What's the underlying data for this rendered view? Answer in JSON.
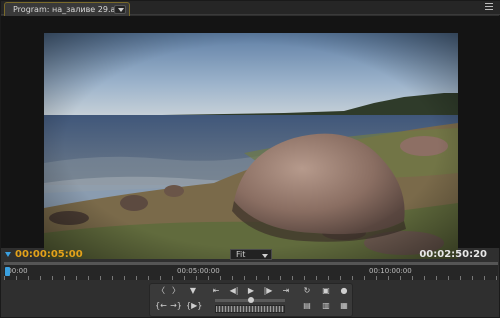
{
  "tab": {
    "label": "Program: на_заливе 29.avi"
  },
  "timecode": {
    "current": "00:00:05:00",
    "duration": "00:02:50:20"
  },
  "zoom": {
    "selected": "Fit"
  },
  "ruler": {
    "labels": [
      ":00:00",
      "00:05:00:00",
      "00:10:00:00"
    ],
    "playhead_fraction": 0.003
  },
  "icons": {
    "mark_in": "mark-in-icon",
    "mark_out": "mark-out-icon",
    "set_marker": "marker-icon",
    "go_to_in": "go-to-in-icon",
    "go_to_out": "go-to-out-icon",
    "play_in_out": "play-in-to-out-icon",
    "step_back": "step-back-icon",
    "play": "play-icon",
    "step_forward": "step-forward-icon",
    "prev_edit": "previous-edit-icon",
    "next_edit": "next-edit-icon",
    "loop": "loop-icon",
    "safe_margins": "safe-margins-icon",
    "output": "output-icon",
    "lift": "lift-icon",
    "extract": "extract-icon",
    "trim_monitor": "trim-icon"
  },
  "colors": {
    "accent": "#e3a21a",
    "playhead": "#3aa0e0"
  }
}
